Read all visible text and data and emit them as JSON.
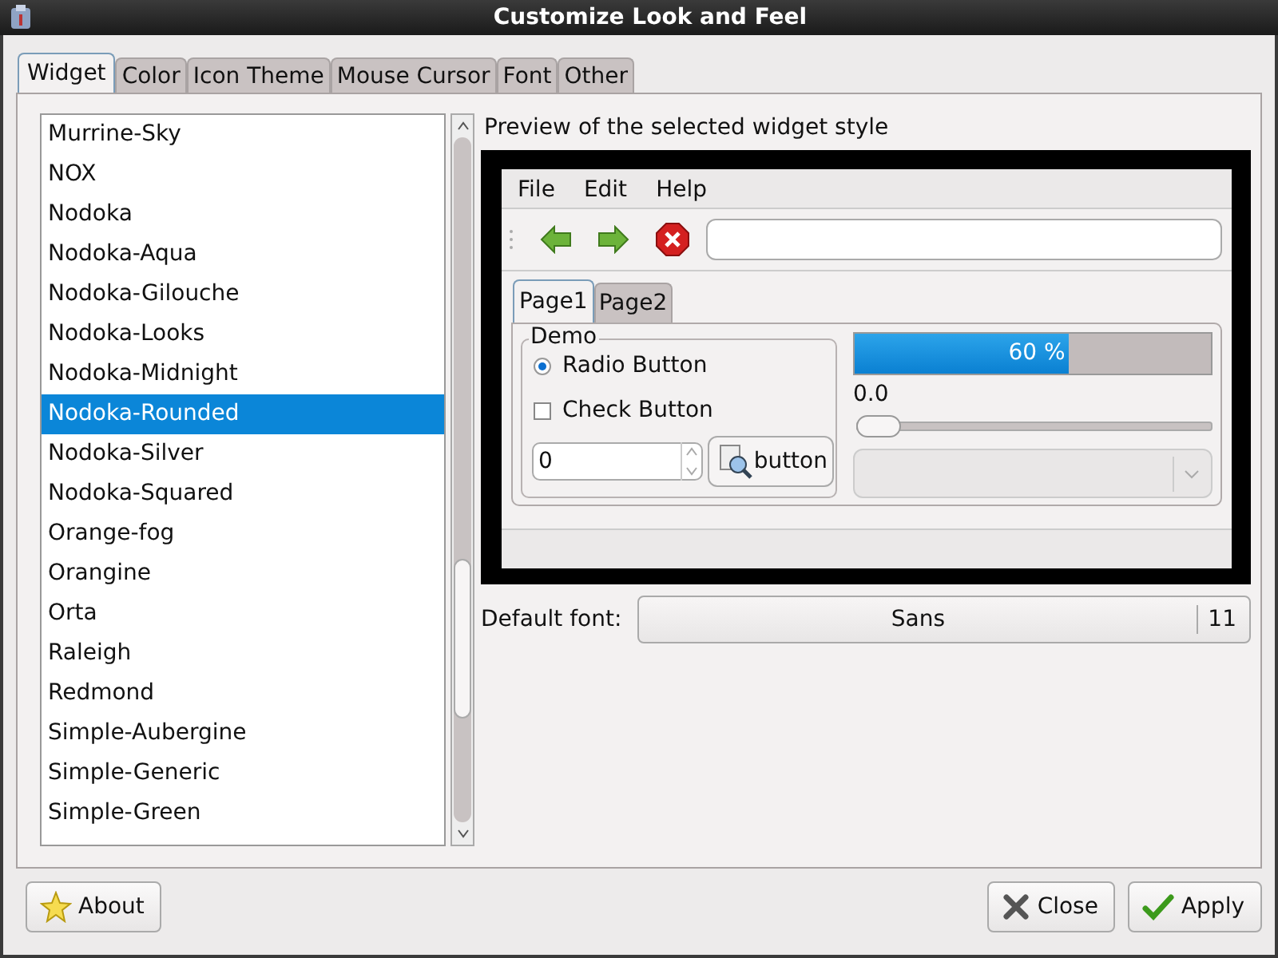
{
  "window": {
    "title": "Customize Look and Feel"
  },
  "tabs": [
    {
      "label": "Widget",
      "selected": true
    },
    {
      "label": "Color",
      "selected": false
    },
    {
      "label": "Icon Theme",
      "selected": false
    },
    {
      "label": "Mouse Cursor",
      "selected": false
    },
    {
      "label": "Font",
      "selected": false
    },
    {
      "label": "Other",
      "selected": false
    }
  ],
  "themes": [
    {
      "name": "Murrine-Sky",
      "selected": false
    },
    {
      "name": "NOX",
      "selected": false
    },
    {
      "name": "Nodoka",
      "selected": false
    },
    {
      "name": "Nodoka-Aqua",
      "selected": false
    },
    {
      "name": "Nodoka-Gilouche",
      "selected": false
    },
    {
      "name": "Nodoka-Looks",
      "selected": false
    },
    {
      "name": "Nodoka-Midnight",
      "selected": false
    },
    {
      "name": "Nodoka-Rounded",
      "selected": true
    },
    {
      "name": "Nodoka-Silver",
      "selected": false
    },
    {
      "name": "Nodoka-Squared",
      "selected": false
    },
    {
      "name": "Orange-fog",
      "selected": false
    },
    {
      "name": "Orangine",
      "selected": false
    },
    {
      "name": "Orta",
      "selected": false
    },
    {
      "name": "Raleigh",
      "selected": false
    },
    {
      "name": "Redmond",
      "selected": false
    },
    {
      "name": "Simple-Aubergine",
      "selected": false
    },
    {
      "name": "Simple-Generic",
      "selected": false
    },
    {
      "name": "Simple-Green",
      "selected": false
    }
  ],
  "preview": {
    "label": "Preview of the selected widget style",
    "menu": [
      "File",
      "Edit",
      "Help"
    ],
    "page_tabs": [
      {
        "label": "Page1",
        "selected": true
      },
      {
        "label": "Page2",
        "selected": false
      }
    ],
    "group": {
      "title": "Demo",
      "radio": {
        "label": "Radio Button",
        "selected": true
      },
      "check": {
        "label": "Check Button",
        "checked": false
      },
      "spin": {
        "value": "0"
      },
      "button": {
        "label": "button"
      }
    },
    "progress": {
      "level": 0.6,
      "text": "60 %"
    },
    "slider": {
      "level": 0,
      "reading": "0.0"
    }
  },
  "default_font": {
    "label": "Default font:",
    "family": "Sans",
    "size": "11"
  },
  "buttons": [
    {
      "kind": "about",
      "label": "About"
    },
    {
      "kind": "close",
      "label": "Close"
    },
    {
      "kind": "apply",
      "label": "Apply"
    }
  ]
}
